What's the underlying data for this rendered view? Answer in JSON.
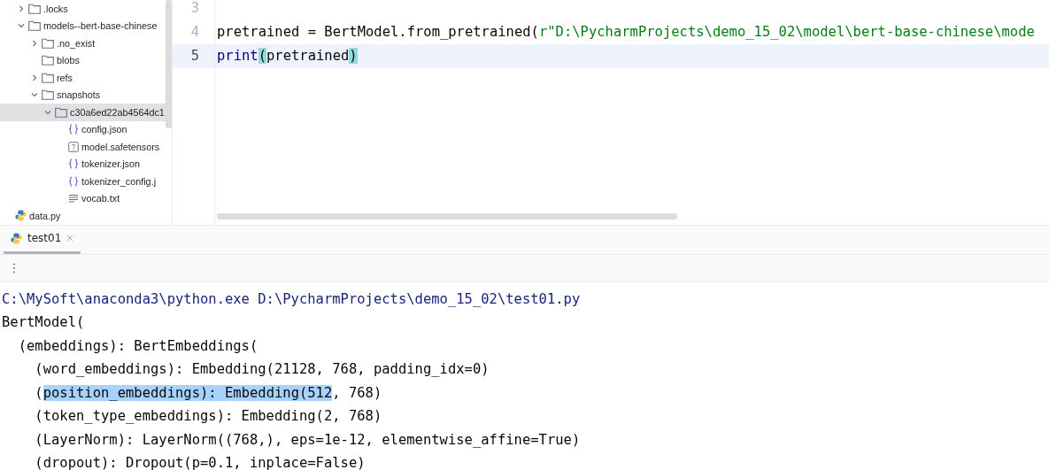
{
  "project_tree": [
    {
      "children": [
        {
          "name": ".locks",
          "kind": "folder",
          "expanded": false
        },
        {
          "name": "models--bert-base-chinese",
          "kind": "folder",
          "expanded": true,
          "children": [
            {
              "name": ".no_exist",
              "kind": "folder",
              "expanded": false
            },
            {
              "name": "blobs",
              "kind": "folder"
            },
            {
              "name": "refs",
              "kind": "folder",
              "expanded": false
            },
            {
              "name": "snapshots",
              "kind": "folder",
              "expanded": true,
              "children": [
                {
                  "name": "c30a6ed22ab4564dc1",
                  "kind": "folder",
                  "expanded": true,
                  "selected": true,
                  "children": [
                    {
                      "name": "config.json",
                      "kind": "json"
                    },
                    {
                      "name": "model.safetensors",
                      "kind": "unknown"
                    },
                    {
                      "name": "tokenizer.json",
                      "kind": "json"
                    },
                    {
                      "name": "tokenizer_config.j",
                      "kind": "json"
                    },
                    {
                      "name": "vocab.txt",
                      "kind": "text"
                    }
                  ]
                }
              ]
            }
          ]
        }
      ]
    },
    {
      "name": "data.py",
      "kind": "python"
    }
  ],
  "editor": {
    "lines": [
      {
        "number": "3",
        "current": false
      },
      {
        "number": "4",
        "current": false,
        "tokens": [
          {
            "text": "pretrained = BertModel.from_pretrained(",
            "kind": "plain"
          },
          {
            "text": "r\"D:\\PycharmProjects\\demo_15_02\\model\\bert-base-chinese\\mode",
            "kind": "string"
          }
        ]
      },
      {
        "number": "5",
        "current": true,
        "tokens": [
          {
            "text": "print",
            "kind": "builtin"
          },
          {
            "text": "(",
            "kind": "brace-match"
          },
          {
            "text": "pretrained",
            "kind": "plain"
          },
          {
            "text": ")",
            "kind": "brace-match"
          }
        ]
      }
    ]
  },
  "run_panel": {
    "tabs": [
      {
        "label": "test01",
        "selected": true
      }
    ],
    "console": [
      {
        "kind": "command",
        "parts": [
          {
            "text": "C:\\MySoft\\anaconda3\\python.exe D:\\PycharmProjects\\demo_15_02\\test01.py",
            "selected": false
          }
        ]
      },
      {
        "kind": "output",
        "parts": [
          {
            "text": "BertModel(",
            "selected": false
          }
        ]
      },
      {
        "kind": "output",
        "parts": [
          {
            "text": "  (embeddings): BertEmbeddings(",
            "selected": false
          }
        ]
      },
      {
        "kind": "output",
        "parts": [
          {
            "text": "    (word_embeddings): Embedding(21128, 768, padding_idx=0)",
            "selected": false
          }
        ]
      },
      {
        "kind": "output",
        "parts": [
          {
            "text": "    (",
            "selected": false
          },
          {
            "text": "position_embeddings): Embedding(512",
            "selected": true
          },
          {
            "text": ", 768)",
            "selected": false
          }
        ]
      },
      {
        "kind": "output",
        "parts": [
          {
            "text": "    (token_type_embeddings): Embedding(2, 768)",
            "selected": false
          }
        ]
      },
      {
        "kind": "output",
        "parts": [
          {
            "text": "    (LayerNorm): LayerNorm((768,), eps=1e-12, elementwise_affine=True)",
            "selected": false
          }
        ]
      },
      {
        "kind": "output",
        "parts": [
          {
            "text": "    (dropout): Dropout(p=0.1, inplace=False)",
            "selected": false
          }
        ]
      }
    ]
  }
}
